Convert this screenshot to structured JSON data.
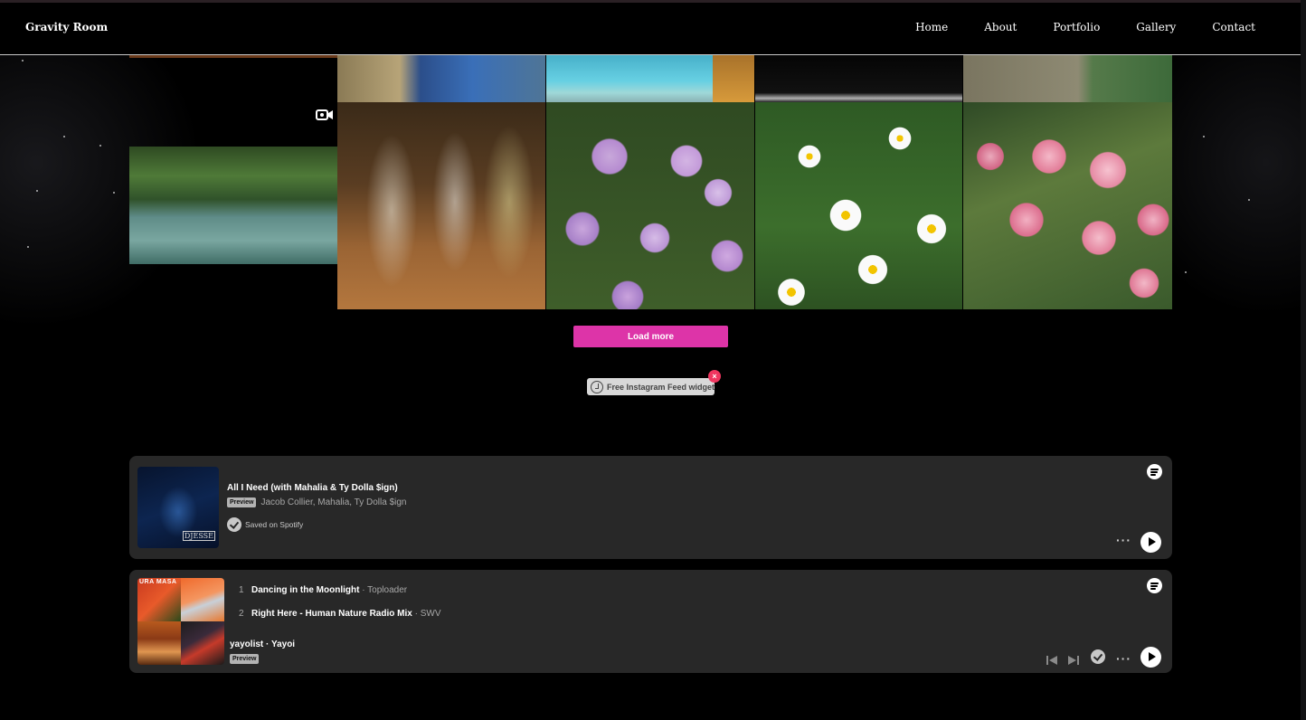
{
  "header": {
    "brand": "Gravity Room",
    "nav": [
      "Home",
      "About",
      "Portfolio",
      "Gallery",
      "Contact"
    ]
  },
  "gallery": {
    "load_more_label": "Load more",
    "widget_badge_label": "Free Instagram Feed widget",
    "widget_close_label": "×"
  },
  "spotify_track": {
    "title": "All I Need (with Mahalia & Ty Dolla $ign)",
    "preview_label": "Preview",
    "artists": "Jacob Collier, Mahalia, Ty Dolla $ign",
    "saved_label": "Saved on Spotify",
    "cover_tag": "DJESSE",
    "more_label": "···"
  },
  "spotify_playlist": {
    "cover_text": "URA MASA",
    "tracks": [
      {
        "num": "1",
        "title": "Dancing in the Moonlight",
        "artist": "Toploader"
      },
      {
        "num": "2",
        "title": "Right Here - Human Nature Radio Mix",
        "artist": "SWV"
      }
    ],
    "separator": "·",
    "playlist_name": "yayolist · Yayoi",
    "preview_label": "Preview",
    "more_label": "···"
  },
  "colors": {
    "accent_pink": "#dd34a8",
    "close_red": "#f0365f",
    "card_bg": "#282828"
  }
}
